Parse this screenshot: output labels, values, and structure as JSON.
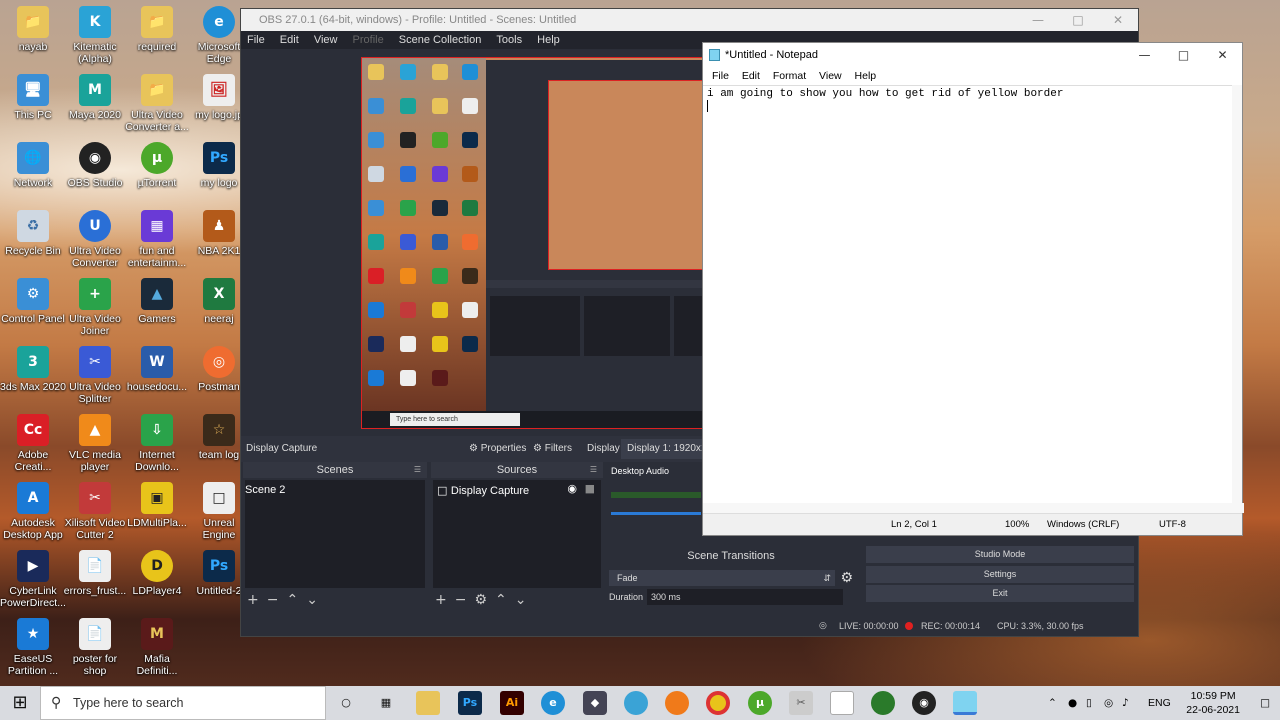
{
  "desktop": {
    "icons": [
      {
        "label": "nayab",
        "glyph": "📁"
      },
      {
        "label": "Kitematic (Alpha)",
        "glyph": "K"
      },
      {
        "label": "required",
        "glyph": "📁"
      },
      {
        "label": "Microsoft Edge",
        "glyph": "e"
      },
      {
        "label": "This PC",
        "glyph": "🖥"
      },
      {
        "label": "Maya 2020",
        "glyph": "M"
      },
      {
        "label": "Ultra Video Converter a...",
        "glyph": "📁"
      },
      {
        "label": "my logo.jp",
        "glyph": "🖼"
      },
      {
        "label": "Network",
        "glyph": "🌐"
      },
      {
        "label": "OBS Studio",
        "glyph": "◉"
      },
      {
        "label": "µTorrent",
        "glyph": "µ"
      },
      {
        "label": "my logo",
        "glyph": "Ps"
      },
      {
        "label": "Recycle Bin",
        "glyph": "♻"
      },
      {
        "label": "Ultra Video Converter",
        "glyph": "U"
      },
      {
        "label": "fun and entertainm...",
        "glyph": "▦"
      },
      {
        "label": "NBA 2K1",
        "glyph": "♟"
      },
      {
        "label": "Control Panel",
        "glyph": "⚙"
      },
      {
        "label": "Ultra Video Joiner",
        "glyph": "+"
      },
      {
        "label": "Gamers",
        "glyph": "▲"
      },
      {
        "label": "neeraj",
        "glyph": "X"
      },
      {
        "label": "3ds Max 2020",
        "glyph": "3"
      },
      {
        "label": "Ultra Video Splitter",
        "glyph": "✂"
      },
      {
        "label": "housedocu...",
        "glyph": "W"
      },
      {
        "label": "Postman",
        "glyph": "◎"
      },
      {
        "label": "Adobe Creati...",
        "glyph": "Cc"
      },
      {
        "label": "VLC media player",
        "glyph": "▲"
      },
      {
        "label": "Internet Downlo...",
        "glyph": "⇩"
      },
      {
        "label": "team log",
        "glyph": "☆"
      },
      {
        "label": "Autodesk Desktop App",
        "glyph": "A"
      },
      {
        "label": "Xilisoft Video Cutter 2",
        "glyph": "✂"
      },
      {
        "label": "LDMultiPla...",
        "glyph": "▣"
      },
      {
        "label": "Unreal Engine",
        "glyph": "□"
      },
      {
        "label": "CyberLink PowerDirect...",
        "glyph": "▶"
      },
      {
        "label": "errors_frust...",
        "glyph": "📄"
      },
      {
        "label": "LDPlayer4",
        "glyph": "D"
      },
      {
        "label": "Untitled-2",
        "glyph": "Ps"
      },
      {
        "label": "EaseUS Partition ...",
        "glyph": "★"
      },
      {
        "label": "poster for shop",
        "glyph": "📄"
      },
      {
        "label": "Mafia Definiti...",
        "glyph": "M"
      }
    ]
  },
  "obs": {
    "title": "OBS 27.0.1 (64-bit, windows) - Profile: Untitled - Scenes: Untitled",
    "menu": [
      "File",
      "Edit",
      "View",
      "Profile",
      "Scene Collection",
      "Tools",
      "Help"
    ],
    "source_toolbar": {
      "source_name": "Display Capture",
      "properties": "Properties",
      "filters": "Filters",
      "display_label": "Display",
      "display_value": "Display 1: 1920x108"
    },
    "scenes": {
      "title": "Scenes",
      "items": [
        "Scene 2"
      ]
    },
    "sources": {
      "title": "Sources",
      "items": [
        "Display Capture"
      ]
    },
    "mixer": {
      "title": "Desktop Audio"
    },
    "transitions": {
      "title": "Scene Transitions",
      "type": "Fade",
      "duration_label": "Duration",
      "duration_value": "300 ms"
    },
    "controls": {
      "studio_mode": "Studio Mode",
      "settings": "Settings",
      "exit": "Exit"
    },
    "status": {
      "live": "LIVE: 00:00:00",
      "rec": "REC: 00:00:14",
      "cpu": "CPU: 3.3%, 30.00 fps"
    }
  },
  "notepad": {
    "title": "*Untitled - Notepad",
    "menu": [
      "File",
      "Edit",
      "Format",
      "View",
      "Help"
    ],
    "text": "i am going to show you how to get rid of yellow border",
    "status": {
      "position": "Ln 2, Col 1",
      "zoom": "100%",
      "eol": "Windows (CRLF)",
      "encoding": "UTF-8"
    }
  },
  "taskbar": {
    "search_placeholder": "Type here to search",
    "language": "ENG",
    "time": "10:59 PM",
    "date": "22-06-2021"
  },
  "colors": {
    "obs_bg": "#2b2e38",
    "obs_dock": "#1e1f26",
    "rec_dot": "#e02020",
    "taskbar": "#d9dbe0"
  }
}
